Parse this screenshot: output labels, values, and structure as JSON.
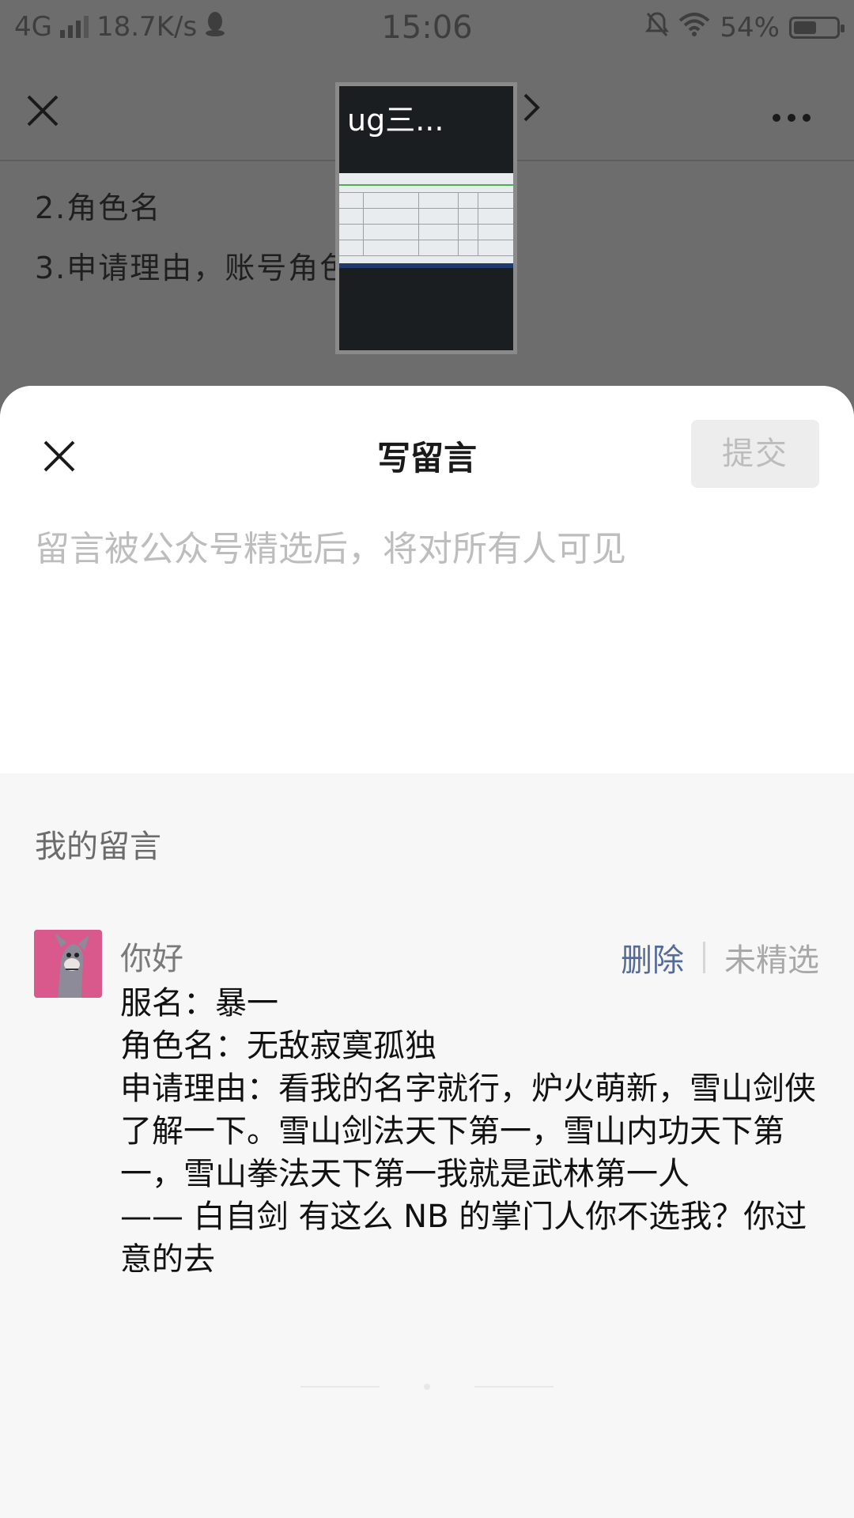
{
  "status_bar": {
    "network": "4G",
    "speed": "18.7K/s",
    "time": "15:06",
    "battery": "54%",
    "battery_level": 0.54,
    "icons": [
      "signal-icon",
      "qq-icon",
      "mute-icon",
      "wifi-icon",
      "battery-icon"
    ]
  },
  "nav": {
    "video_title": "ug三...",
    "icons": [
      "close-icon",
      "chevron-right-icon",
      "more-icon"
    ]
  },
  "article": {
    "line2": "2.角色名",
    "line3": "3.申请理由，账号角色"
  },
  "sheet": {
    "title": "写留言",
    "submit_label": "提交",
    "placeholder": "留言被公众号精选后，将对所有人可见",
    "input_value": ""
  },
  "my_comments": {
    "title": "我的留言",
    "items": [
      {
        "user": "你好",
        "delete_label": "删除",
        "status": "未精选",
        "body": "服名：暴一\n角色名：无敌寂寞孤独\n申请理由：看我的名字就行，炉火萌新，雪山剑侠了解一下。雪山剑法天下第一，雪山内功天下第一，雪山拳法天下第一我就是武林第一人\n—— 白自剑 有这么 NB 的掌门人你不选我？你过意的去"
      }
    ]
  },
  "colors": {
    "link": "#576b95",
    "placeholder": "#bdbdbd",
    "submit_disabled_bg": "#ededed",
    "avatar_bg": "#d9598c"
  }
}
